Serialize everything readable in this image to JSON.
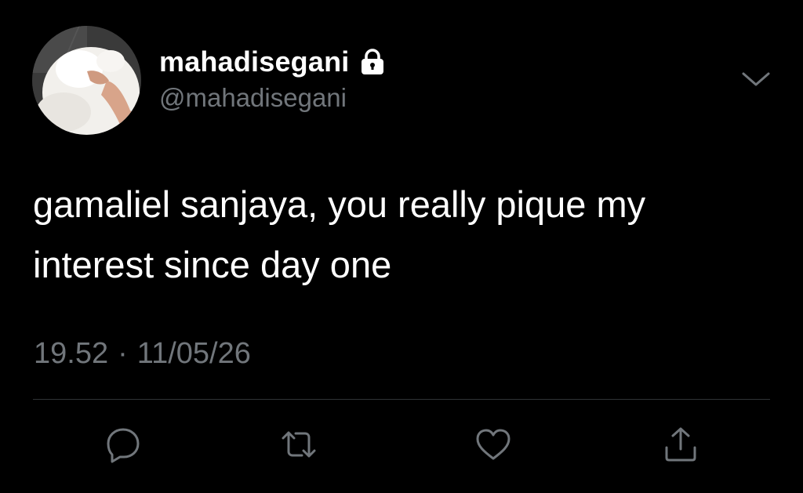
{
  "author": {
    "display_name": "mahadisegani",
    "handle": "@mahadisegani",
    "protected_icon": "lock-icon",
    "avatar": "avatar-photo"
  },
  "tweet": {
    "text": "gamaliel sanjaya, you really pique my interest since day one",
    "time": "19.52",
    "separator": "·",
    "date": "11/05/26"
  },
  "menu_icon": "chevron-down-icon",
  "actions": [
    {
      "name": "reply",
      "icon": "reply-icon"
    },
    {
      "name": "retweet",
      "icon": "retweet-icon"
    },
    {
      "name": "like",
      "icon": "heart-icon"
    },
    {
      "name": "share",
      "icon": "share-icon"
    }
  ],
  "colors": {
    "background": "#000000",
    "primary_text": "#ffffff",
    "secondary_text": "#71767b",
    "divider": "#2f3336"
  }
}
